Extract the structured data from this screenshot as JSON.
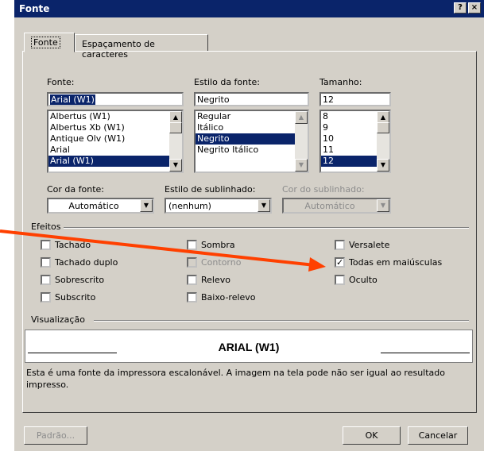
{
  "window": {
    "title": "Fonte",
    "help_btn": "?",
    "close_btn": "×"
  },
  "tabs": [
    {
      "label": "Fonte"
    },
    {
      "label": "Espaçamento de caracteres"
    }
  ],
  "font": {
    "label": "Fonte:",
    "value": "Arial (W1)",
    "items": [
      "Albertus (W1)",
      "Albertus Xb (W1)",
      "Antique Olv (W1)",
      "Arial",
      "Arial (W1)"
    ]
  },
  "style": {
    "label": "Estilo da fonte:",
    "value": "Negrito",
    "items": [
      "Regular",
      "Itálico",
      "Negrito",
      "Negrito Itálico"
    ]
  },
  "size": {
    "label": "Tamanho:",
    "value": "12",
    "items": [
      "8",
      "9",
      "10",
      "11",
      "12"
    ]
  },
  "color": {
    "label": "Cor da fonte:",
    "value": "Automático"
  },
  "underline": {
    "label": "Estilo de sublinhado:",
    "value": "(nenhum)"
  },
  "underline_color": {
    "label": "Cor do sublinhado:",
    "value": "Automático"
  },
  "effects": {
    "label": "Efeitos",
    "items": {
      "tachado": "Tachado",
      "tachado_duplo": "Tachado duplo",
      "sobrescrito": "Sobrescrito",
      "subscrito": "Subscrito",
      "sombra": "Sombra",
      "contorno": "Contorno",
      "relevo": "Relevo",
      "baixo_relevo": "Baixo-relevo",
      "versalete": "Versalete",
      "todas_maiusculas": "Todas em maiúsculas",
      "oculto": "Oculto"
    },
    "checked": {
      "todas_maiusculas": true
    }
  },
  "preview": {
    "label": "Visualização",
    "sample": "ARIAL (W1)",
    "description": "Esta é uma fonte da impressora escalonável. A imagem na tela pode não ser igual ao resultado impresso."
  },
  "buttons": {
    "default": "Padrão...",
    "ok": "OK",
    "cancel": "Cancelar"
  },
  "colors": {
    "titlebar": "#0a246a",
    "dialog_bg": "#d4d0c8",
    "annotation_arrow": "#ff4000"
  }
}
